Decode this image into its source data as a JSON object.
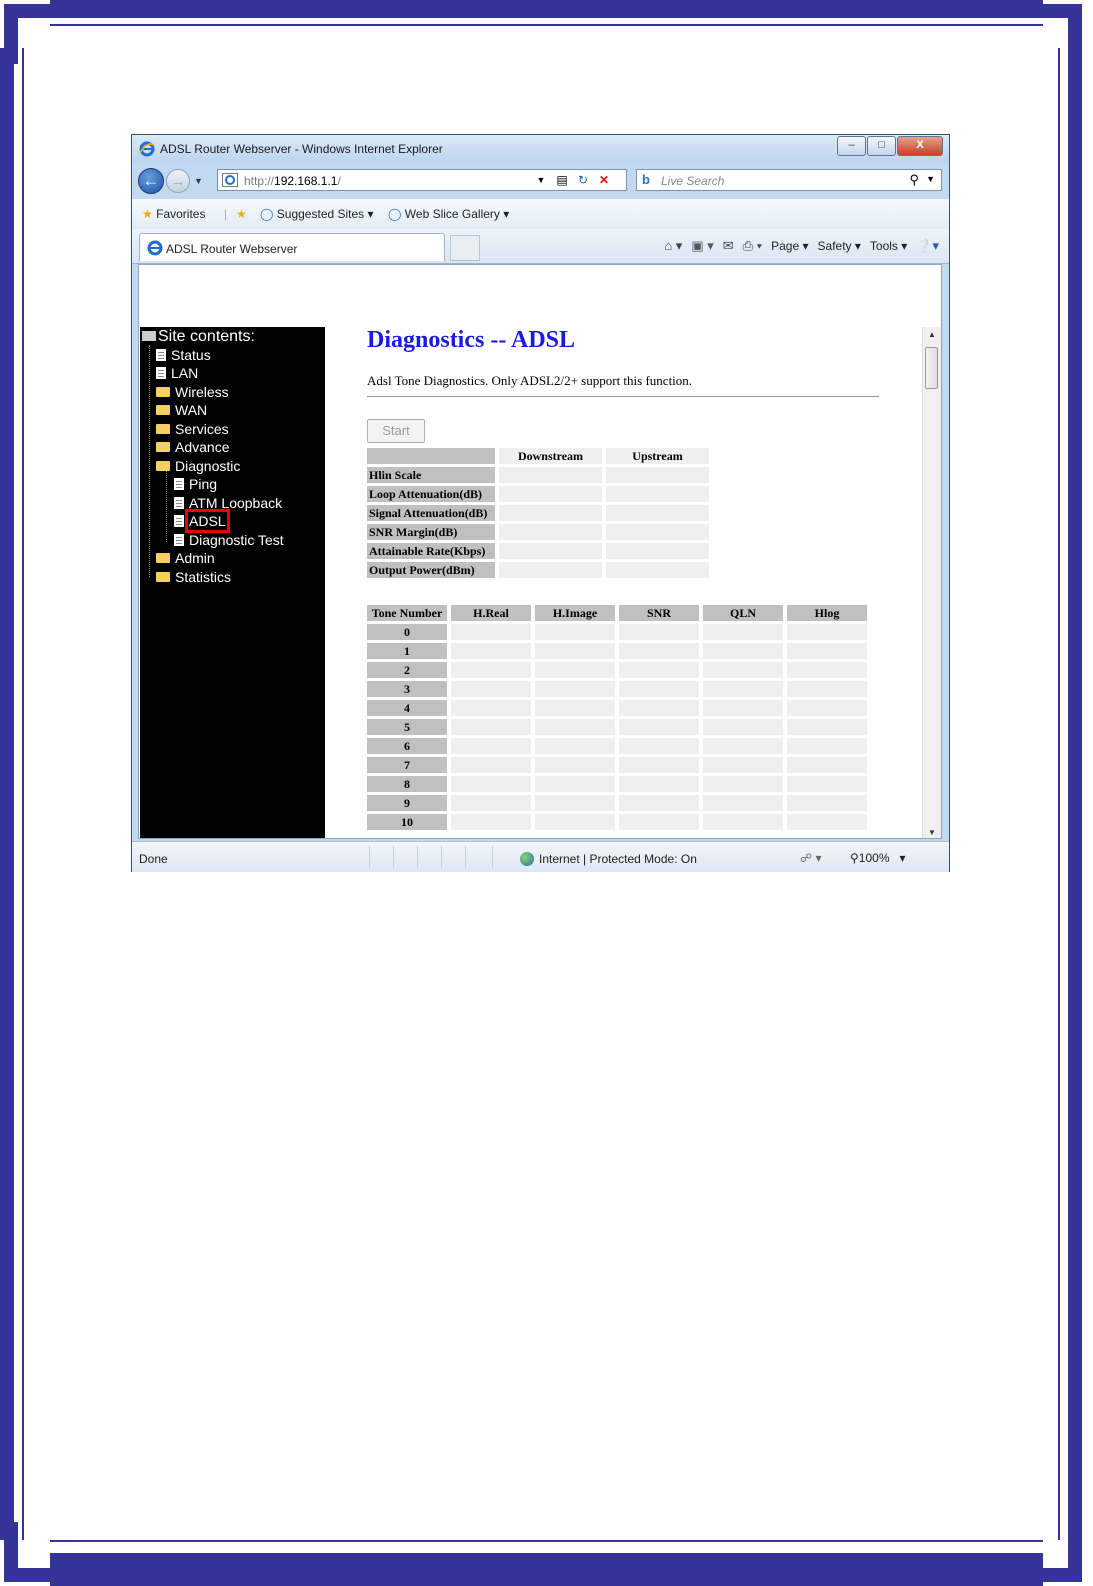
{
  "window": {
    "title": "ADSL Router Webserver - Windows Internet Explorer",
    "minimize": "–",
    "maximize": "□",
    "close": "X"
  },
  "address": {
    "prefix": "http://",
    "host": "192.168.1.1",
    "suffix": "/"
  },
  "search": {
    "placeholder": "Live Search"
  },
  "favorites": {
    "label": "Favorites",
    "items": [
      "Suggested Sites ▾",
      "Web Slice Gallery ▾"
    ]
  },
  "tab": {
    "label": "ADSL Router Webserver"
  },
  "commands": [
    "Page ▾",
    "Safety ▾",
    "Tools ▾"
  ],
  "sidebar": {
    "heading": "Site contents:",
    "items": [
      {
        "label": "Status",
        "type": "doc",
        "level": 1
      },
      {
        "label": "LAN",
        "type": "doc",
        "level": 1
      },
      {
        "label": "Wireless",
        "type": "folder",
        "level": 1
      },
      {
        "label": "WAN",
        "type": "folder",
        "level": 1
      },
      {
        "label": "Services",
        "type": "folder",
        "level": 1
      },
      {
        "label": "Advance",
        "type": "folder",
        "level": 1
      },
      {
        "label": "Diagnostic",
        "type": "folder-open",
        "level": 1
      },
      {
        "label": "Ping",
        "type": "doc",
        "level": 2
      },
      {
        "label": "ATM Loopback",
        "type": "doc",
        "level": 2
      },
      {
        "label": "ADSL",
        "type": "doc",
        "level": 2
      },
      {
        "label": "Diagnostic Test",
        "type": "doc",
        "level": 2
      },
      {
        "label": "Admin",
        "type": "folder",
        "level": 1
      },
      {
        "label": "Statistics",
        "type": "folder",
        "level": 1
      }
    ]
  },
  "main": {
    "title": "Diagnostics -- ADSL",
    "description": "Adsl Tone Diagnostics. Only ADSL2/2+ support this function.",
    "start_button": "Start",
    "summary": {
      "headers": [
        "",
        "Downstream",
        "Upstream"
      ],
      "rows": [
        "Hlin Scale",
        "Loop Attenuation(dB)",
        "Signal Attenuation(dB)",
        "SNR Margin(dB)",
        "Attainable Rate(Kbps)",
        "Output Power(dBm)"
      ]
    },
    "tones": {
      "headers": [
        "Tone Number",
        "H.Real",
        "H.Image",
        "SNR",
        "QLN",
        "Hlog"
      ],
      "rows": [
        "0",
        "1",
        "2",
        "3",
        "4",
        "5",
        "6",
        "7",
        "8",
        "9",
        "10"
      ]
    }
  },
  "status": {
    "text": "Done",
    "zone": "Internet | Protected Mode: On",
    "zoom": "100%"
  },
  "colors": {
    "frame": "#333399",
    "title_blue": "#1a1ae6",
    "sidebar_bg": "#000000",
    "highlight": "#e00000"
  }
}
